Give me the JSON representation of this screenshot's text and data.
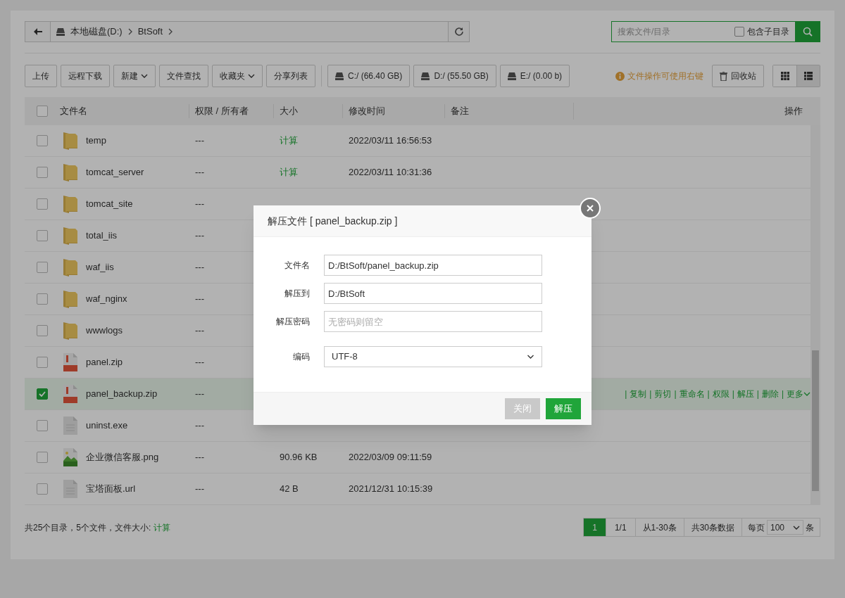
{
  "path_bar": {
    "crumbs": [
      "本地磁盘(D:)",
      "BtSoft"
    ]
  },
  "search": {
    "placeholder": "搜索文件/目录",
    "include_subdirs": {
      "label": "包含子目录",
      "checked": false
    }
  },
  "toolbar": {
    "buttons": [
      {
        "label": "上传",
        "dropdown": false
      },
      {
        "label": "远程下载",
        "dropdown": false
      },
      {
        "label": "新建",
        "dropdown": true
      },
      {
        "label": "文件查找",
        "dropdown": false
      },
      {
        "label": "收藏夹",
        "dropdown": true
      },
      {
        "label": "分享列表",
        "dropdown": false
      }
    ],
    "disks": [
      "C:/ (66.40 GB)",
      "D:/ (55.50 GB)",
      "E:/ (0.00 b)"
    ],
    "tip": "文件操作可使用右键",
    "recycle": "回收站",
    "views": [
      {
        "kind": "grid",
        "selected": false
      },
      {
        "kind": "list",
        "selected": true
      }
    ]
  },
  "table": {
    "select_all": {
      "checked": false
    },
    "columns": [
      "文件名",
      "权限 / 所有者",
      "大小",
      "修改时间",
      "备注",
      "操作"
    ],
    "rows": [
      {
        "kind": "folder",
        "name": "temp",
        "perm": "---",
        "size": "计算",
        "size_link": true,
        "date": "2022/03/11 16:56:53",
        "selected": false
      },
      {
        "kind": "folder",
        "name": "tomcat_server",
        "perm": "---",
        "size": "计算",
        "size_link": true,
        "date": "2022/03/11 10:31:36",
        "selected": false
      },
      {
        "kind": "folder",
        "name": "tomcat_site",
        "perm": "---",
        "selected": false
      },
      {
        "kind": "folder",
        "name": "total_iis",
        "perm": "---",
        "selected": false
      },
      {
        "kind": "folder",
        "name": "waf_iis",
        "perm": "---",
        "selected": false
      },
      {
        "kind": "folder",
        "name": "waf_nginx",
        "perm": "---",
        "selected": false
      },
      {
        "kind": "folder",
        "name": "wwwlogs",
        "perm": "---",
        "selected": false
      },
      {
        "kind": "zip",
        "name": "panel.zip",
        "perm": "---",
        "selected": false
      },
      {
        "kind": "zip",
        "name": "panel_backup.zip",
        "perm": "---",
        "selected": true,
        "actions": [
          "复制",
          "剪切",
          "重命名",
          "权限",
          "解压",
          "删除",
          "更多"
        ],
        "separator": "|"
      },
      {
        "kind": "file",
        "name": "uninst.exe",
        "perm": "---",
        "selected": false
      },
      {
        "kind": "image",
        "name": "企业微信客服.png",
        "perm": "---",
        "size": "90.96 KB",
        "size_link": false,
        "date": "2022/03/09 09:11:59",
        "selected": false
      },
      {
        "kind": "file",
        "name": "宝塔面板.url",
        "perm": "---",
        "size": "42 B",
        "size_link": false,
        "date": "2021/12/31 10:15:39",
        "selected": false
      }
    ]
  },
  "footer": {
    "summary": "共25个目录，5个文件，文件大小:",
    "summary_link": "计算",
    "pages": [
      {
        "label": "1",
        "selected": true
      },
      {
        "label": "1/1",
        "selected": false
      }
    ],
    "range": "从1-30条",
    "total": "共30条数据",
    "per_page_label": "每页",
    "per_page": "100",
    "per_page_unit": "条"
  },
  "dialog": {
    "title": "解压文件 [ panel_backup.zip ]",
    "fields": [
      {
        "kind": "text",
        "label": "文件名",
        "value": "D:/BtSoft/panel_backup.zip"
      },
      {
        "kind": "text",
        "label": "解压到",
        "value": "D:/BtSoft"
      },
      {
        "kind": "text",
        "label": "解压密码",
        "placeholder": "无密码则留空"
      },
      {
        "kind": "select",
        "label": "编码",
        "value": "UTF-8"
      }
    ],
    "buttons": [
      {
        "label": "关闭",
        "primary": false
      },
      {
        "label": "解压",
        "primary": true
      }
    ]
  }
}
